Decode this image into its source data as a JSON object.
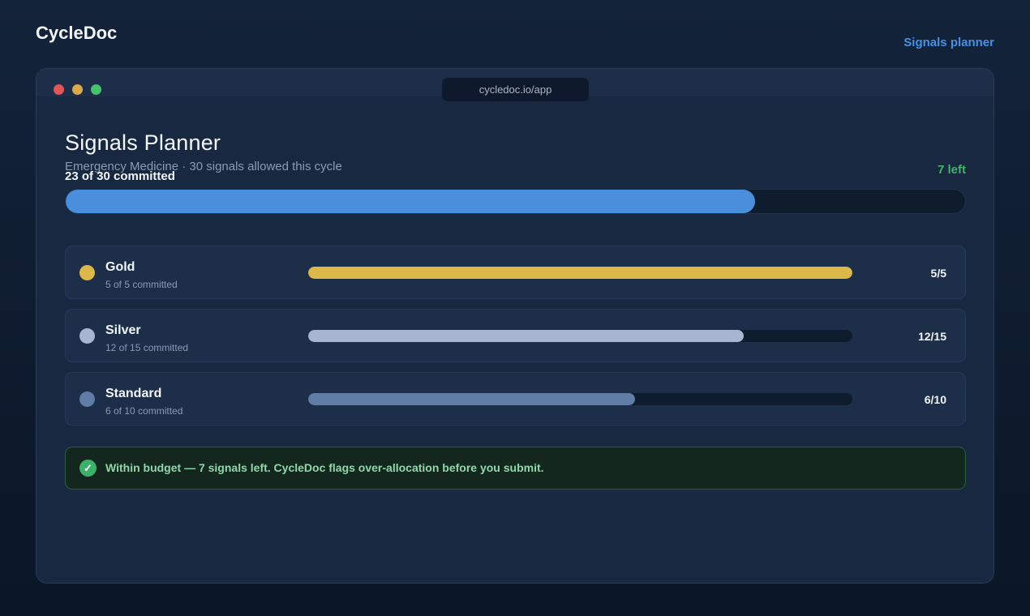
{
  "brand": "CycleDoc",
  "nav": {
    "link_label": "Signals planner"
  },
  "browser": {
    "url": "cycledoc.io/app"
  },
  "planner": {
    "title": "Signals Planner",
    "subtitle": "Emergency Medicine · 30 signals allowed this cycle",
    "committed_label": "23 of 30 committed",
    "left_label": "7 left",
    "committed": 23,
    "total": 30
  },
  "tiers": [
    {
      "name": "Gold",
      "sub": "5 of 5 committed",
      "count": "5/5",
      "committed": 5,
      "total": 5,
      "color": "#dcb84a"
    },
    {
      "name": "Silver",
      "sub": "12 of 15 committed",
      "count": "12/15",
      "committed": 12,
      "total": 15,
      "color": "#a7b5cf"
    },
    {
      "name": "Standard",
      "sub": "6 of 10 committed",
      "count": "6/10",
      "committed": 6,
      "total": 10,
      "color": "#5f7da6"
    }
  ],
  "notice": {
    "icon": "check-icon",
    "text": "Within budget — 7 signals left. CycleDoc flags over-allocation before you submit."
  },
  "colors": {
    "accent": "#4a8fdb",
    "success": "#3fb466",
    "close": "#e0575b",
    "minimize": "#d9a94a",
    "maximize": "#45c26b"
  }
}
